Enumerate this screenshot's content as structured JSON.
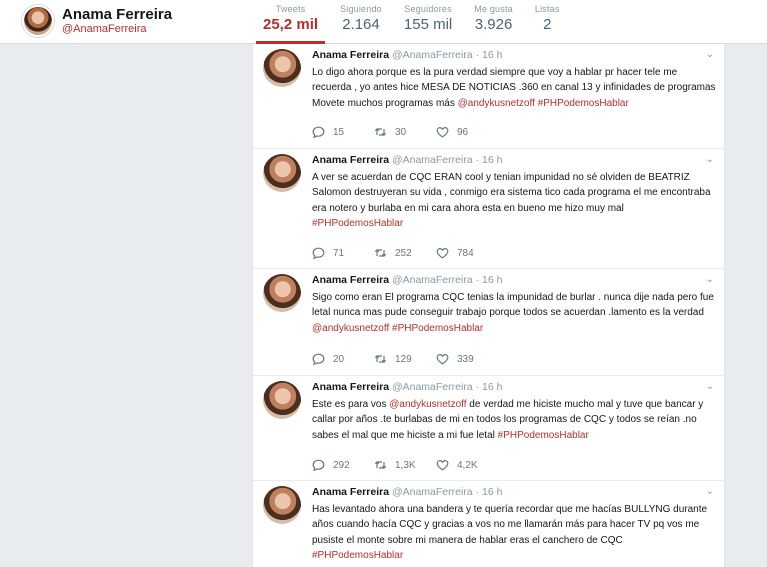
{
  "profile": {
    "name": "Anama Ferreira",
    "handle": "@AnamaFerreira"
  },
  "stats": [
    {
      "label": "Tweets",
      "value": "25,2 mil",
      "active": true
    },
    {
      "label": "Siguiendo",
      "value": "2.164"
    },
    {
      "label": "Seguidores",
      "value": "155 mil"
    },
    {
      "label": "Me gusta",
      "value": "3.926"
    },
    {
      "label": "Listas",
      "value": "2"
    }
  ],
  "icons": {
    "reply": "reply-icon",
    "retweet": "retweet-icon",
    "like": "heart-icon",
    "menu": "chevron-down-icon"
  },
  "colors": {
    "accent": "#b4302a",
    "stat_text": "#4a6378",
    "meta": "#8899a6"
  },
  "tweets": [
    {
      "name": "Anama Ferreira",
      "meta": "@AnamaFerreira · 16 h",
      "text_before": "Lo digo ahora porque es la pura verdad siempre que voy a hablar pr hacer tele me recuerda , yo antes hice MESA DE NOTICIAS .360 en canal 13 y infinidades de programas Movete muchos programas más ",
      "mention": "@andykusnetzoff",
      "text_middle": " ",
      "hashtag": "#PHPodemosHablar",
      "replies": "15",
      "retweets": "30",
      "likes": "96"
    },
    {
      "name": "Anama Ferreira",
      "meta": "@AnamaFerreira · 16 h",
      "text_before": "A ver se acuerdan de CQC ERAN cool y tenian impunidad no sé olviden de BEATRIZ Salomon destruyeran su vida , conmigo era sistema tico cada programa el me encontraba era notero y burlaba en mi cara ahora esta en bueno me hizo muy mal ",
      "mention": "",
      "text_middle": "",
      "hashtag": "#PHPodemosHablar",
      "replies": "71",
      "retweets": "252",
      "likes": "784"
    },
    {
      "name": "Anama Ferreira",
      "meta": "@AnamaFerreira · 16 h",
      "text_before": "Sigo como eran El programa CQC tenias la impunidad de burlar . nunca dije nada pero fue letal nunca mas pude conseguir trabajo porque todos se acuerdan .lamento es la verdad ",
      "mention": "@andykusnetzoff",
      "text_middle": " ",
      "hashtag": "#PHPodemosHablar",
      "replies": "20",
      "retweets": "129",
      "likes": "339"
    },
    {
      "name": "Anama Ferreira",
      "meta": "@AnamaFerreira · 16 h",
      "text_before": "Este es para vos ",
      "mention": "@andykusnetzoff",
      "text_middle": " de verdad me hiciste mucho mal y tuve que bancar y callar por años .te burlabas de mi en todos los programas de CQC  y todos se reían .no sabes el mal que me hiciste a mi fue letal  ",
      "hashtag": "#PHPodemosHablar",
      "replies": "292",
      "retweets": "1,3K",
      "likes": "4,2K"
    },
    {
      "name": "Anama Ferreira",
      "meta": "@AnamaFerreira · 16 h",
      "text_before": "Has levantado ahora una bandera y te quería recordar que me hacías BULLYNG durante años cuando hacía CQC y gracias a vos no me llamarán más para hacer TV pq vos me pusiste el monte sobre mi manera de hablar eras el canchero de CQC ",
      "mention": "",
      "text_middle": "",
      "hashtag": "#PHPodemosHablar",
      "replies": "",
      "retweets": "",
      "likes": ""
    }
  ]
}
